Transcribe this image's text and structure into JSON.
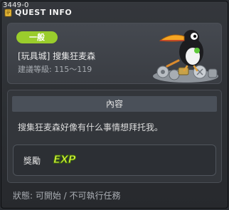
{
  "quest_id": "3449-0",
  "title": "QUEST INFO",
  "header": {
    "category": "一般",
    "quest_name": "[玩具城] 搜集狂麦森",
    "level_range": "建議等級: 115～119"
  },
  "content": {
    "section_title": "內容",
    "description": "搜集狂麦森好像有什么事情想拜托我。",
    "reward_label": "獎勵",
    "reward_exp": "EXP"
  },
  "status": "狀態: 可開始 / 不可執行任務",
  "colors": {
    "category_badge": "#9acd2c",
    "exp_fill": "#d4f23a"
  },
  "icons": {
    "title_icon": "quest-book-icon",
    "npc": "toucan-bird-on-junk-pile"
  }
}
